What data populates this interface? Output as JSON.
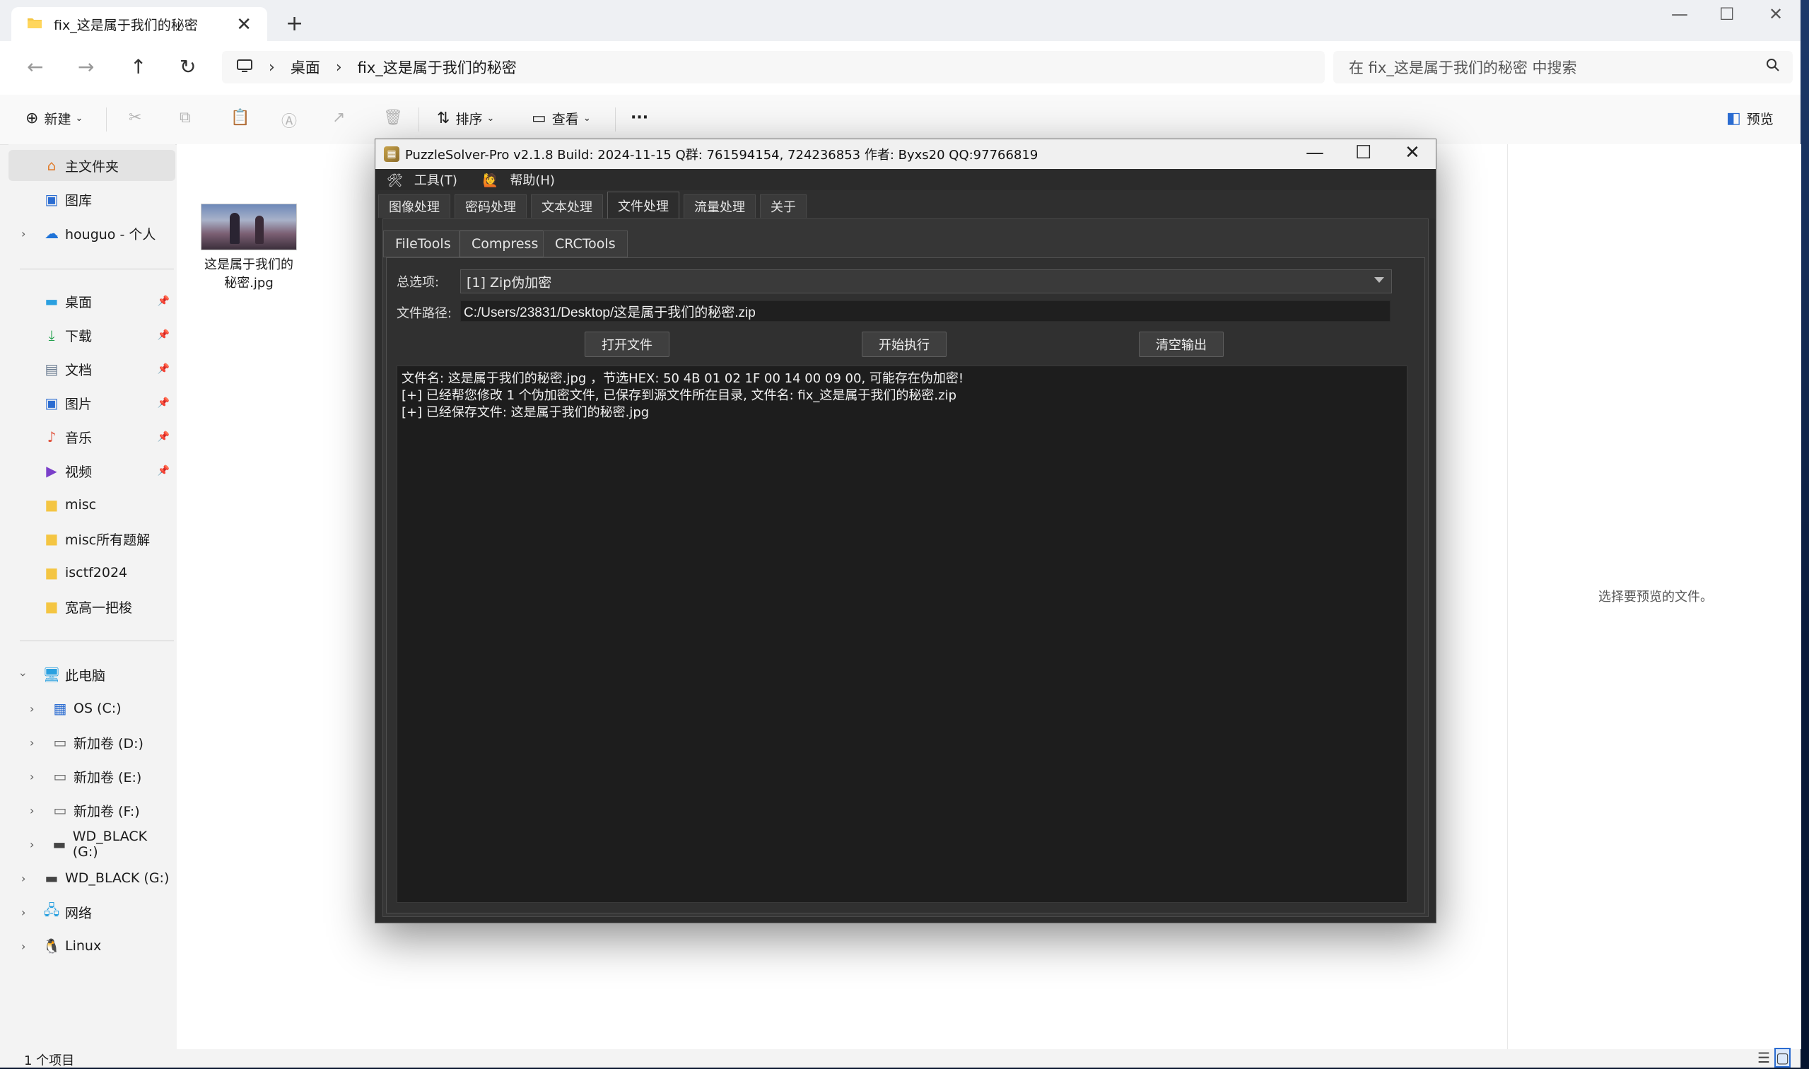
{
  "explorer": {
    "tab_title": "fix_这是属于我们的秘密",
    "tab_close": "✕",
    "new_tab": "+",
    "window_controls": {
      "minimize": "—",
      "maximize": "☐",
      "close": "✕"
    },
    "nav": {
      "back": "←",
      "forward": "→",
      "up": "↑",
      "refresh": "↻"
    },
    "breadcrumb": [
      "桌面",
      "fix_这是属于我们的秘密"
    ],
    "breadcrumb_sep": "›",
    "search_placeholder": "在 fix_这是属于我们的秘密 中搜索",
    "toolbar": {
      "new": "新建",
      "sort": "排序",
      "view": "查看",
      "more": "···",
      "preview": "预览"
    },
    "sidebar": {
      "home": "主文件夹",
      "gallery": "图库",
      "onedrive": "houguo - 个人",
      "quick": [
        {
          "label": "桌面"
        },
        {
          "label": "下载"
        },
        {
          "label": "文档"
        },
        {
          "label": "图片"
        },
        {
          "label": "音乐"
        },
        {
          "label": "视频"
        },
        {
          "label": "misc"
        },
        {
          "label": "misc所有题解"
        },
        {
          "label": "isctf2024"
        },
        {
          "label": "宽高一把梭"
        }
      ],
      "this_pc": "此电脑",
      "drives": [
        "OS (C:)",
        "新加卷 (D:)",
        "新加卷 (E:)",
        "新加卷 (F:)",
        "WD_BLACK (G:)"
      ],
      "wd_black": "WD_BLACK (G:)",
      "network": "网络",
      "linux": "Linux"
    },
    "file": {
      "name_line1": "这是属于我们的",
      "name_line2": "秘密.jpg"
    },
    "preview_msg": "选择要预览的文件。",
    "status_count": "1 个项目"
  },
  "puzzlesolver": {
    "title": "PuzzleSolver-Pro v2.1.8  Build: 2024-11-15  Q群: 761594154, 724236853  作者: Byxs20  QQ:97766819",
    "menu": {
      "tools": "工具(T)",
      "help": "帮助(H)"
    },
    "tabs": [
      "图像处理",
      "密码处理",
      "文本处理",
      "文件处理",
      "流量处理",
      "关于"
    ],
    "active_tab": "文件处理",
    "sub_tabs": [
      "FileTools",
      "Compress",
      "CRCTools"
    ],
    "active_sub_tab": "Compress",
    "option_label": "总选项:",
    "option_value": "[1] Zip伪加密",
    "path_label": "文件路径:",
    "path_value": "C:/Users/23831/Desktop/这是属于我们的秘密.zip",
    "buttons": {
      "open": "打开文件",
      "run": "开始执行",
      "clear": "清空输出"
    },
    "output_lines": [
      "文件名: 这是属于我们的秘密.jpg ，节选HEX: 50 4B 01 02 1F 00 14 00 09 00, 可能存在伪加密!",
      "[+] 已经帮您修改 1 个伪加密文件, 已保存到源文件所在目录, 文件名: fix_这是属于我们的秘密.zip",
      "[+] 已经保存文件: 这是属于我们的秘密.jpg"
    ]
  }
}
